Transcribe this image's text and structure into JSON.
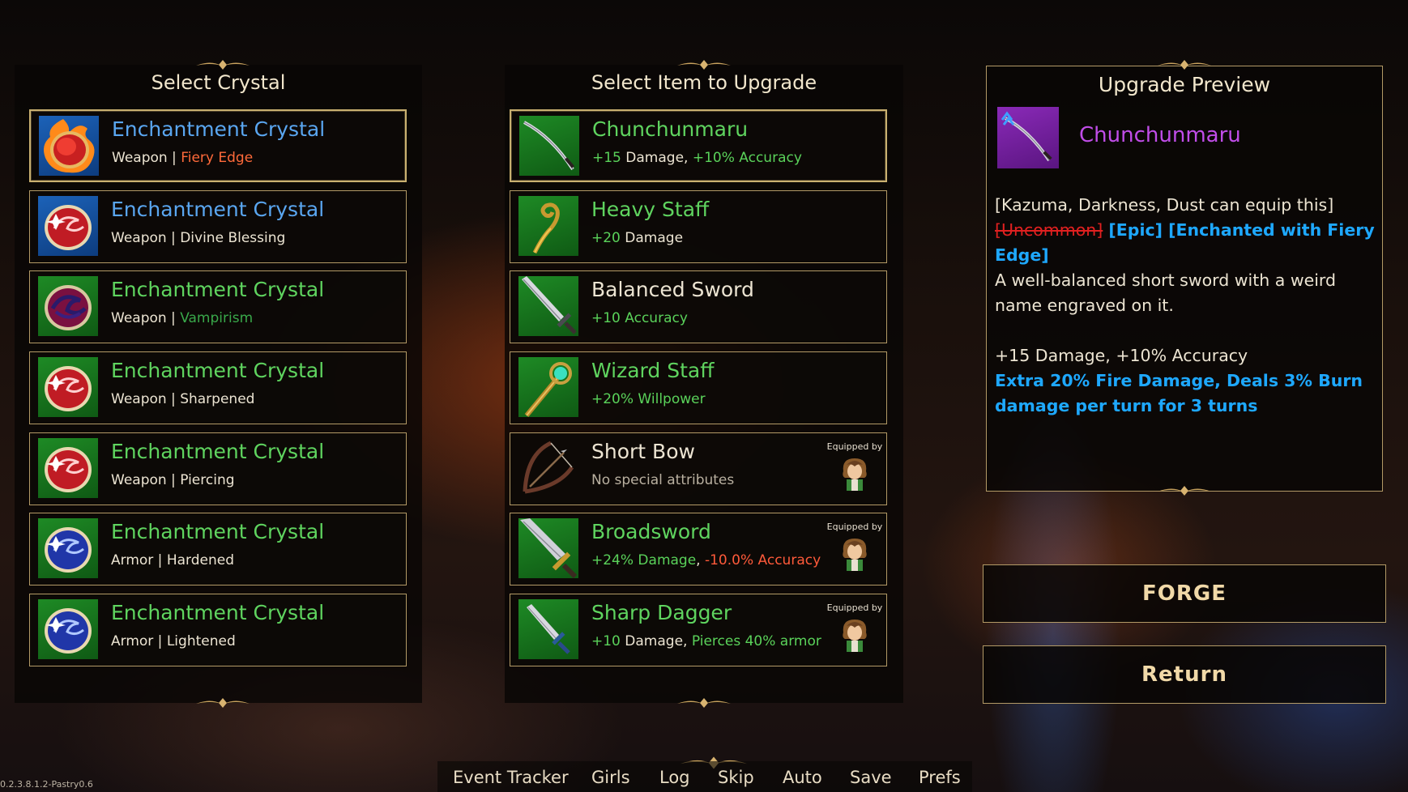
{
  "crystal_panel": {
    "title": "Select Crystal",
    "items": [
      {
        "name": "Enchantment Crystal",
        "type": "Weapon",
        "sep": " | ",
        "effect": "Fiery Edge",
        "color": "#5aa6f0",
        "effect_color": "#ff6a3a",
        "gem": "fire",
        "selected": true
      },
      {
        "name": "Enchantment Crystal",
        "type": "Weapon",
        "sep": " | ",
        "effect": "Divine Blessing",
        "color": "#5aa6f0",
        "effect_color": "#ece4d2",
        "gem": "red",
        "selected": false
      },
      {
        "name": "Enchantment Crystal",
        "type": "Weapon",
        "sep": " | ",
        "effect": "Vampirism",
        "color": "#5fd45f",
        "effect_color": "#39a84a",
        "gem": "dark",
        "selected": false
      },
      {
        "name": "Enchantment Crystal",
        "type": "Weapon",
        "sep": " | ",
        "effect": "Sharpened",
        "color": "#5fd45f",
        "effect_color": "#ece4d2",
        "gem": "red",
        "selected": false
      },
      {
        "name": "Enchantment Crystal",
        "type": "Weapon",
        "sep": " | ",
        "effect": "Piercing",
        "color": "#5fd45f",
        "effect_color": "#ece4d2",
        "gem": "red",
        "selected": false
      },
      {
        "name": "Enchantment Crystal",
        "type": "Armor",
        "sep": " | ",
        "effect": "Hardened",
        "color": "#5fd45f",
        "effect_color": "#ece4d2",
        "gem": "blue",
        "selected": false
      },
      {
        "name": "Enchantment Crystal",
        "type": "Armor",
        "sep": " | ",
        "effect": "Lightened",
        "color": "#5fd45f",
        "effect_color": "#ece4d2",
        "gem": "blue",
        "selected": false
      }
    ]
  },
  "item_panel": {
    "title": "Select Item to Upgrade",
    "equipped_label": "Equipped by",
    "items": [
      {
        "name": "Chunchunmaru",
        "stats": [
          "+15",
          " Damage",
          ", ",
          "+10% Accuracy"
        ],
        "stat_colors": [
          "#5ad25a",
          "#ece4d2",
          "#ece4d2",
          "#5ad25a"
        ],
        "icon": "katana",
        "name_color": "#5fd45f",
        "selected": true,
        "equipped": false
      },
      {
        "name": "Heavy Staff",
        "stats": [
          "+20",
          " Damage"
        ],
        "stat_colors": [
          "#5ad25a",
          "#ece4d2"
        ],
        "icon": "staff",
        "name_color": "#5fd45f",
        "selected": false,
        "equipped": false
      },
      {
        "name": "Balanced Sword",
        "stats": [
          "+10 Accuracy"
        ],
        "stat_colors": [
          "#5ad25a"
        ],
        "icon": "sword",
        "name_color": "#ece4d2",
        "selected": false,
        "equipped": false
      },
      {
        "name": "Wizard Staff",
        "stats": [
          "+20% Willpower"
        ],
        "stat_colors": [
          "#5ad25a"
        ],
        "icon": "wizard",
        "name_color": "#5fd45f",
        "selected": false,
        "equipped": false
      },
      {
        "name": "Short Bow",
        "stats": [
          "No special attributes"
        ],
        "stat_colors": [
          "#b9b0a0"
        ],
        "icon": "bow",
        "name_color": "#ece4d2",
        "selected": false,
        "equipped": true
      },
      {
        "name": "Broadsword",
        "stats": [
          "+24% Damage",
          ", ",
          "-10.0% Accuracy"
        ],
        "stat_colors": [
          "#5ad25a",
          "#ece4d2",
          "#ff5a3a"
        ],
        "icon": "broadsword",
        "name_color": "#5fd45f",
        "selected": false,
        "equipped": true
      },
      {
        "name": "Sharp Dagger",
        "stats": [
          "+10",
          " Damage",
          ", ",
          "Pierces 40% armor"
        ],
        "stat_colors": [
          "#5ad25a",
          "#ece4d2",
          "#ece4d2",
          "#5ad25a"
        ],
        "icon": "dagger",
        "name_color": "#5fd45f",
        "selected": false,
        "equipped": true
      }
    ]
  },
  "preview": {
    "title": "Upgrade Preview",
    "item_name": "Chunchunmaru",
    "equip_line": "[Kazuma, Darkness, Dust can equip this]",
    "old_rarity": "[Uncommon]",
    "new_tags": " [Epic] [Enchanted with Fiery Edge]",
    "description": "A well-balanced short sword with a weird name engraved on it.",
    "stats": "+15 Damage, +10% Accuracy",
    "enchant_effect": "Extra 20% Fire Damage, Deals 3% Burn damage per turn for 3 turns"
  },
  "buttons": {
    "forge": "FORGE",
    "return": "Return"
  },
  "quick_menu": [
    "Event Tracker",
    "Girls",
    "Log",
    "Skip",
    "Auto",
    "Save",
    "Prefs"
  ],
  "version": "0.2.3.8.1.2-Pastry0.6"
}
